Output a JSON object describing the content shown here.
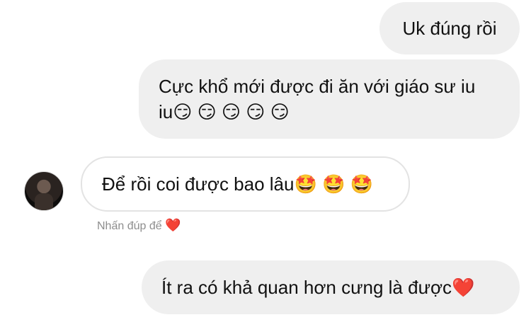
{
  "messages": [
    {
      "text": "Uk đúng rồi"
    },
    {
      "line1": "Cực khổ mới được đi ăn với giáo sư iu",
      "line2": "iu",
      "emojis": "😏 😏 😏 😏 😏"
    },
    {
      "text": "Để rồi coi được bao lâu",
      "emojis": "🤩 🤩 🤩"
    },
    {
      "text": "Ít ra có khả quan hơn cưng là được",
      "emojis": "❤️"
    }
  ],
  "reaction_hint": {
    "label": "Nhấn đúp để",
    "heart": "❤️"
  },
  "colors": {
    "sent_bg": "#efefef",
    "recv_border": "#e3e3e3",
    "hint": "#8e8e8e"
  }
}
